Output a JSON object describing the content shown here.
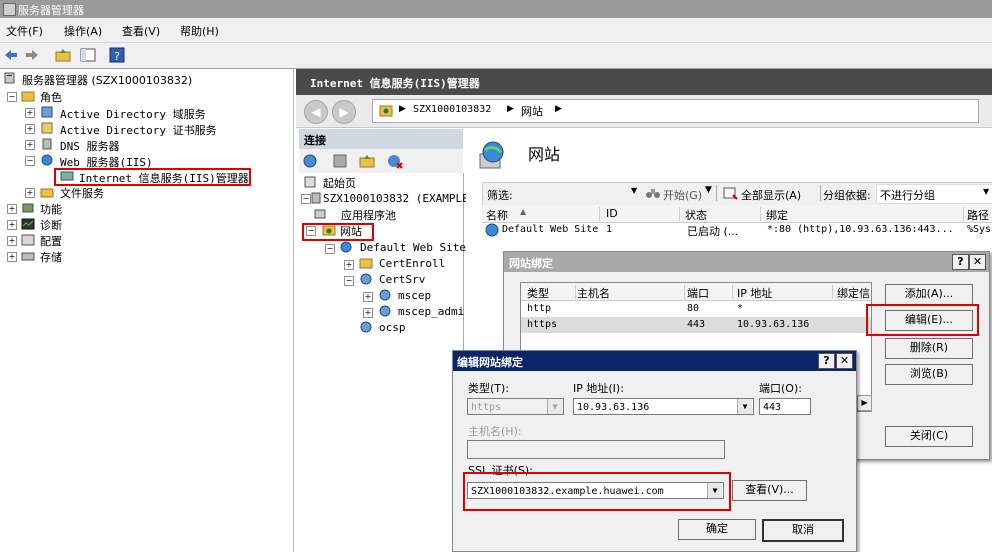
{
  "window": {
    "title": "服务器管理器"
  },
  "menu": [
    "文件(F)",
    "操作(A)",
    "查看(V)",
    "帮助(H)"
  ],
  "tree": {
    "root": "服务器管理器 (SZX1000103832)",
    "roles": "角色",
    "ad_ds": "Active Directory 域服务",
    "ad_cs": "Active Directory 证书服务",
    "dns": "DNS 服务器",
    "web": "Web 服务器(IIS)",
    "iis_mgr": "Internet 信息服务(IIS)管理器",
    "file": "文件服务",
    "features": "功能",
    "diagnostics": "诊断",
    "config": "配置",
    "storage": "存储"
  },
  "iis": {
    "header": "Internet 信息服务(IIS)管理器",
    "breadcrumb": [
      "SZX1000103832",
      "网站"
    ],
    "connections_title": "连接",
    "conn_tree": {
      "start": "起始页",
      "server": "SZX1000103832 (EXAMPLE\\",
      "apppools": "应用程序池",
      "sites": "网站",
      "default_site": "Default Web Site",
      "certenroll": "CertEnroll",
      "certsrv": "CertSrv",
      "mscep": "mscep",
      "mscep_admin": "mscep_admi",
      "ocsp": "ocsp"
    },
    "page_title": "网站",
    "filter": {
      "label": "筛选:",
      "go": "开始(G)",
      "show_all": "全部显示(A)",
      "group_by": "分组依据:",
      "group_value": "不进行分组"
    },
    "columns": [
      "名称",
      "ID",
      "状态",
      "绑定",
      "路径"
    ],
    "rows": [
      {
        "name": "Default Web Site",
        "id": "1",
        "status": "已启动 (...",
        "binding": "*:80 (http),10.93.63.136:443...",
        "path": "%Sys"
      }
    ]
  },
  "bindings_dialog": {
    "title": "网站绑定",
    "columns": [
      "类型",
      "主机名",
      "端口",
      "IP 地址",
      "绑定信"
    ],
    "rows": [
      {
        "type": "http",
        "host": "",
        "port": "80",
        "ip": "*"
      },
      {
        "type": "https",
        "host": "",
        "port": "443",
        "ip": "10.93.63.136"
      }
    ],
    "buttons": {
      "add": "添加(A)...",
      "edit": "编辑(E)...",
      "remove": "删除(R)",
      "browse": "浏览(B)",
      "close": "关闭(C)"
    }
  },
  "edit_dialog": {
    "title": "编辑网站绑定",
    "type_label": "类型(T):",
    "type_value": "https",
    "ip_label": "IP 地址(I):",
    "ip_value": "10.93.63.136",
    "port_label": "端口(O):",
    "port_value": "443",
    "host_label": "主机名(H):",
    "host_value": "",
    "ssl_label": "SSL 证书(S):",
    "ssl_value": "SZX1000103832.example.huawei.com",
    "view_button": "查看(V)...",
    "ok": "确定",
    "cancel": "取消"
  },
  "colors": {
    "highlight_red": "#e00000",
    "dialog_active_title": "#0a246a",
    "dialog_inactive_title": "#a0a0a0"
  }
}
